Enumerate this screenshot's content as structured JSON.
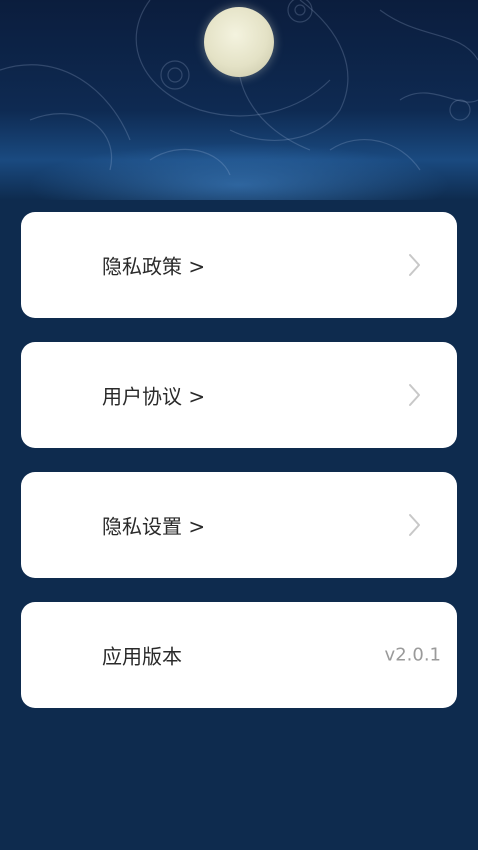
{
  "header": {
    "decor_icon": "ornate-swirl-pattern",
    "moon_icon": "full-moon"
  },
  "menu": {
    "items": [
      {
        "label": "隐私政策 >",
        "icon": "chevron-right-icon"
      },
      {
        "label": "用户协议 >",
        "icon": "chevron-right-icon"
      },
      {
        "label": "隐私设置 >",
        "icon": "chevron-right-icon"
      }
    ],
    "version": {
      "label": "应用版本",
      "value": "v2.0.1"
    }
  },
  "colors": {
    "background": "#0e2b4e",
    "card": "#ffffff",
    "label_text": "#2a2a2a",
    "chevron": "#c8c8c8",
    "version_text": "#9a9a9a"
  }
}
